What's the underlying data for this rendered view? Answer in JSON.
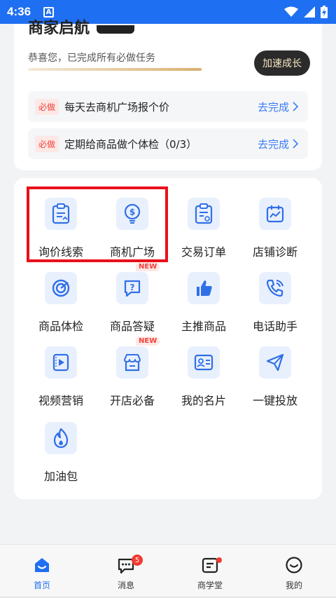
{
  "status_bar": {
    "time": "4:36",
    "notification_icon": "A",
    "icons": [
      "wifi-icon",
      "signal-icon",
      "battery-charging-icon"
    ]
  },
  "header_card": {
    "shop_title": "商家启航",
    "congrats_text": "恭喜您，已完成所有必做任务",
    "accelerate_button": "加速成长",
    "tasks": [
      {
        "tag": "必做",
        "text": "每天去商机广场报个价",
        "action": "去完成"
      },
      {
        "tag": "必做",
        "text": "定期给商品做个体检（0/3）",
        "action": "去完成"
      }
    ]
  },
  "tools": {
    "items": [
      {
        "label": "询价线索",
        "icon": "clipboard-inquiry-icon"
      },
      {
        "label": "商机广场",
        "icon": "dollar-bulb-icon"
      },
      {
        "label": "交易订单",
        "icon": "order-clipboard-icon"
      },
      {
        "label": "店铺诊断",
        "icon": "calendar-chart-icon"
      },
      {
        "label": "商品体检",
        "icon": "radar-check-icon"
      },
      {
        "label": "商品答疑",
        "icon": "question-chat-icon",
        "tag": "NEW"
      },
      {
        "label": "主推商品",
        "icon": "thumbs-up-icon"
      },
      {
        "label": "电话助手",
        "icon": "phone-icon"
      },
      {
        "label": "视频营销",
        "icon": "video-play-icon"
      },
      {
        "label": "开店必备",
        "icon": "storefront-icon",
        "tag": "NEW"
      },
      {
        "label": "我的名片",
        "icon": "business-card-icon"
      },
      {
        "label": "一键投放",
        "icon": "paper-plane-icon"
      },
      {
        "label": "加油包",
        "icon": "flame-icon"
      }
    ]
  },
  "tab_bar": {
    "tabs": [
      {
        "label": "首页",
        "icon": "home-icon",
        "active": true
      },
      {
        "label": "消息",
        "icon": "message-icon",
        "badge": "5"
      },
      {
        "label": "商学堂",
        "icon": "course-icon",
        "dot": true
      },
      {
        "label": "我的",
        "icon": "profile-smile-icon"
      }
    ]
  },
  "colors": {
    "brand_blue": "#1f6ff2",
    "highlight_red": "#e8101b",
    "icon_bg": "#e9f0fd"
  }
}
